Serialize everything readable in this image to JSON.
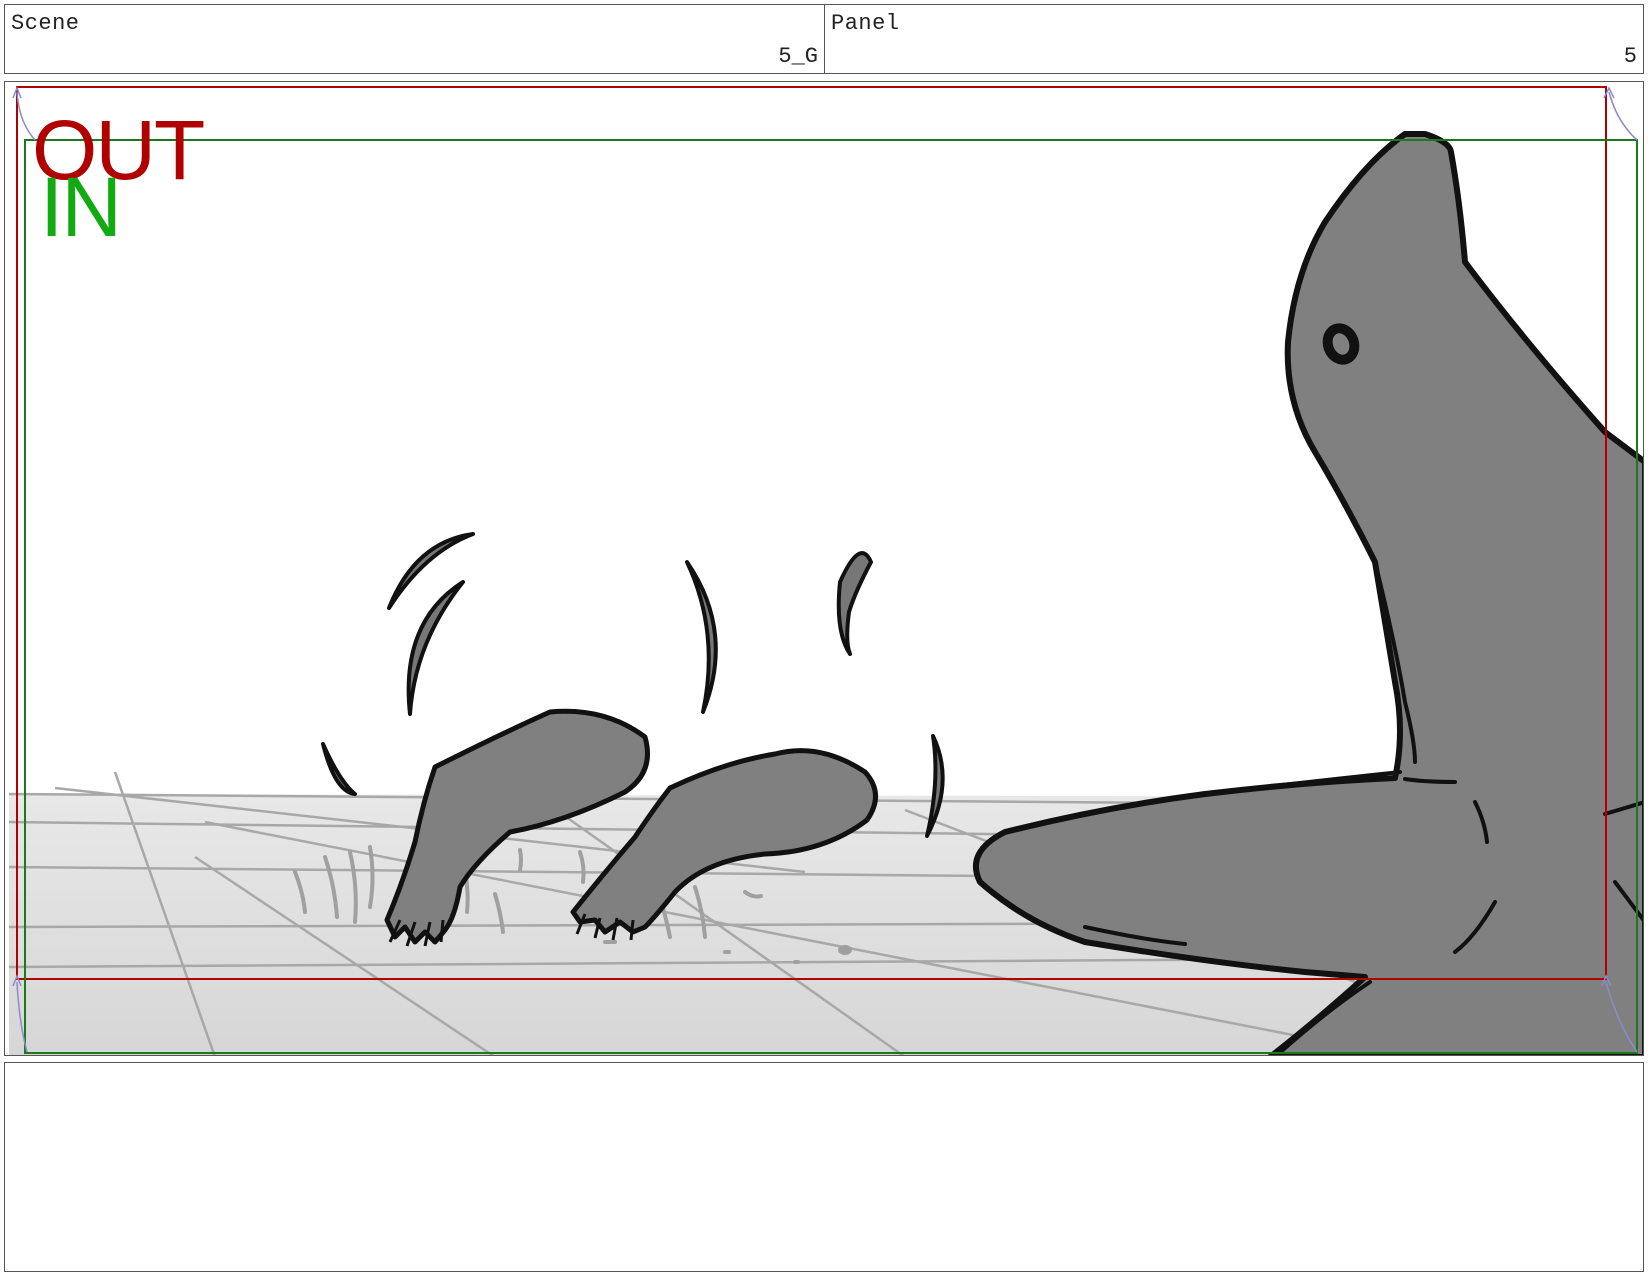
{
  "header": {
    "scene_label": "Scene",
    "scene_value": "5_G",
    "panel_label": "Panel",
    "panel_value": "5"
  },
  "frame": {
    "out_label": "OUT",
    "in_label": "IN",
    "out_color": "#b00000",
    "in_color": "#11aa11"
  },
  "notes": {
    "text": ""
  }
}
